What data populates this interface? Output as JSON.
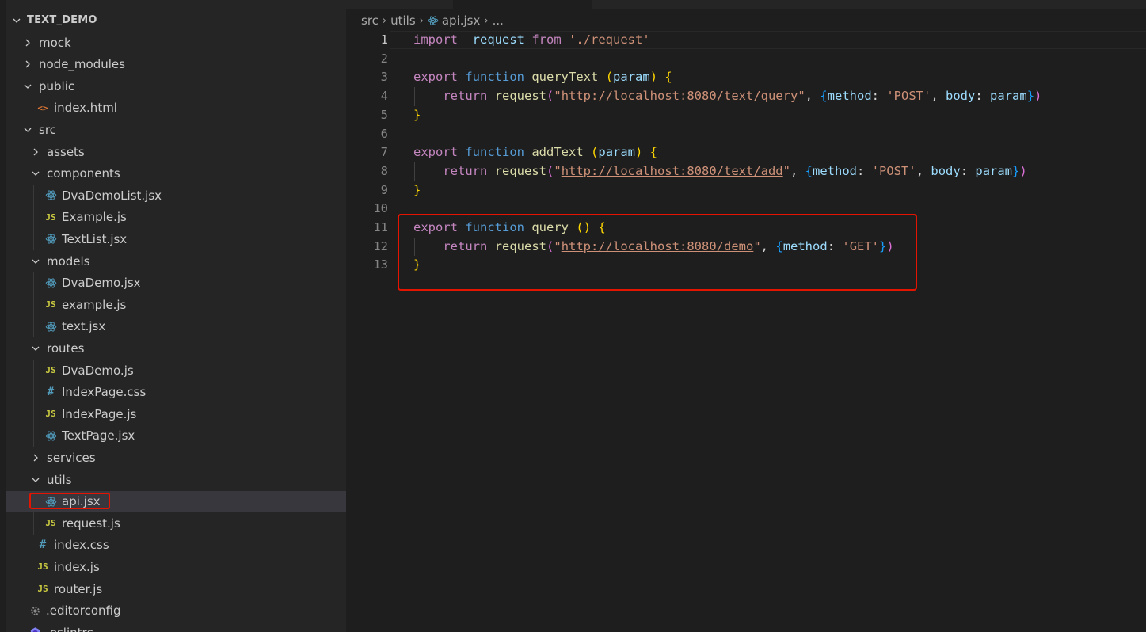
{
  "explorer": {
    "root": "TEXT_DEMO",
    "items": [
      {
        "label": "mock",
        "type": "folder",
        "open": false,
        "depth": 0
      },
      {
        "label": "node_modules",
        "type": "folder",
        "open": false,
        "depth": 0
      },
      {
        "label": "public",
        "type": "folder",
        "open": true,
        "depth": 0
      },
      {
        "label": "index.html",
        "type": "html",
        "depth": 1
      },
      {
        "label": "src",
        "type": "folder",
        "open": true,
        "depth": 0
      },
      {
        "label": "assets",
        "type": "folder",
        "open": false,
        "depth": 1
      },
      {
        "label": "components",
        "type": "folder",
        "open": true,
        "depth": 1
      },
      {
        "label": "DvaDemoList.jsx",
        "type": "react",
        "depth": 2
      },
      {
        "label": "Example.js",
        "type": "js",
        "depth": 2
      },
      {
        "label": "TextList.jsx",
        "type": "react",
        "depth": 2
      },
      {
        "label": "models",
        "type": "folder",
        "open": true,
        "depth": 1
      },
      {
        "label": "DvaDemo.jsx",
        "type": "react",
        "depth": 2
      },
      {
        "label": "example.js",
        "type": "js",
        "depth": 2
      },
      {
        "label": "text.jsx",
        "type": "react",
        "depth": 2
      },
      {
        "label": "routes",
        "type": "folder",
        "open": true,
        "depth": 1
      },
      {
        "label": "DvaDemo.js",
        "type": "js",
        "depth": 2
      },
      {
        "label": "IndexPage.css",
        "type": "css",
        "depth": 2
      },
      {
        "label": "IndexPage.js",
        "type": "js",
        "depth": 2
      },
      {
        "label": "TextPage.jsx",
        "type": "react",
        "depth": 2
      },
      {
        "label": "services",
        "type": "folder",
        "open": false,
        "depth": 1
      },
      {
        "label": "utils",
        "type": "folder",
        "open": true,
        "depth": 1
      },
      {
        "label": "api.jsx",
        "type": "react",
        "depth": 2,
        "selected": true
      },
      {
        "label": "request.js",
        "type": "js",
        "depth": 2
      },
      {
        "label": "index.css",
        "type": "css",
        "depth": 1
      },
      {
        "label": "index.js",
        "type": "js",
        "depth": 1
      },
      {
        "label": "router.js",
        "type": "js",
        "depth": 1
      },
      {
        "label": ".editorconfig",
        "type": "config",
        "depth": 0
      },
      {
        "label": ".eslintrc",
        "type": "eslint",
        "depth": 0
      }
    ]
  },
  "breadcrumb": {
    "parts": [
      "src",
      "utils",
      "api.jsx",
      "..."
    ]
  },
  "editor": {
    "file": "api.jsx",
    "active_line": 1,
    "lines": [
      {
        "n": "1",
        "tokens": [
          [
            "kw",
            "import"
          ],
          [
            "pl",
            "  "
          ],
          [
            "id",
            "request"
          ],
          [
            "pl",
            " "
          ],
          [
            "kw",
            "from"
          ],
          [
            "pl",
            " "
          ],
          [
            "str",
            "'./request'"
          ]
        ]
      },
      {
        "n": "2",
        "tokens": []
      },
      {
        "n": "3",
        "tokens": [
          [
            "kw",
            "export"
          ],
          [
            "pl",
            " "
          ],
          [
            "kwb",
            "function"
          ],
          [
            "pl",
            " "
          ],
          [
            "fn",
            "queryText"
          ],
          [
            "pl",
            " "
          ],
          [
            "br1",
            "("
          ],
          [
            "id",
            "param"
          ],
          [
            "br1",
            ")"
          ],
          [
            "pl",
            " "
          ],
          [
            "br1",
            "{"
          ]
        ]
      },
      {
        "n": "4",
        "tokens": [
          [
            "pl",
            "    "
          ],
          [
            "kw",
            "return"
          ],
          [
            "pl",
            " "
          ],
          [
            "fn",
            "request"
          ],
          [
            "br2",
            "("
          ],
          [
            "str",
            "\""
          ],
          [
            "url",
            "http://localhost:8080/text/query"
          ],
          [
            "str",
            "\""
          ],
          [
            "pl",
            ", "
          ],
          [
            "br3",
            "{"
          ],
          [
            "id",
            "method"
          ],
          [
            "pl",
            ": "
          ],
          [
            "str",
            "'POST'"
          ],
          [
            "pl",
            ", "
          ],
          [
            "id",
            "body"
          ],
          [
            "pl",
            ": "
          ],
          [
            "id",
            "param"
          ],
          [
            "br3",
            "}"
          ],
          [
            "br2",
            ")"
          ]
        ]
      },
      {
        "n": "5",
        "tokens": [
          [
            "br1",
            "}"
          ]
        ]
      },
      {
        "n": "6",
        "tokens": []
      },
      {
        "n": "7",
        "tokens": [
          [
            "kw",
            "export"
          ],
          [
            "pl",
            " "
          ],
          [
            "kwb",
            "function"
          ],
          [
            "pl",
            " "
          ],
          [
            "fn",
            "addText"
          ],
          [
            "pl",
            " "
          ],
          [
            "br1",
            "("
          ],
          [
            "id",
            "param"
          ],
          [
            "br1",
            ")"
          ],
          [
            "pl",
            " "
          ],
          [
            "br1",
            "{"
          ]
        ]
      },
      {
        "n": "8",
        "tokens": [
          [
            "pl",
            "    "
          ],
          [
            "kw",
            "return"
          ],
          [
            "pl",
            " "
          ],
          [
            "fn",
            "request"
          ],
          [
            "br2",
            "("
          ],
          [
            "str",
            "\""
          ],
          [
            "url",
            "http://localhost:8080/text/add"
          ],
          [
            "str",
            "\""
          ],
          [
            "pl",
            ", "
          ],
          [
            "br3",
            "{"
          ],
          [
            "id",
            "method"
          ],
          [
            "pl",
            ": "
          ],
          [
            "str",
            "'POST'"
          ],
          [
            "pl",
            ", "
          ],
          [
            "id",
            "body"
          ],
          [
            "pl",
            ": "
          ],
          [
            "id",
            "param"
          ],
          [
            "br3",
            "}"
          ],
          [
            "br2",
            ")"
          ]
        ]
      },
      {
        "n": "9",
        "tokens": [
          [
            "br1",
            "}"
          ]
        ]
      },
      {
        "n": "10",
        "tokens": []
      },
      {
        "n": "11",
        "tokens": [
          [
            "kw",
            "export"
          ],
          [
            "pl",
            " "
          ],
          [
            "kwb",
            "function"
          ],
          [
            "pl",
            " "
          ],
          [
            "fn",
            "query"
          ],
          [
            "pl",
            " "
          ],
          [
            "br1",
            "()"
          ],
          [
            "pl",
            " "
          ],
          [
            "br1",
            "{"
          ]
        ]
      },
      {
        "n": "12",
        "tokens": [
          [
            "pl",
            "    "
          ],
          [
            "kw",
            "return"
          ],
          [
            "pl",
            " "
          ],
          [
            "fn",
            "request"
          ],
          [
            "br2",
            "("
          ],
          [
            "str",
            "\""
          ],
          [
            "url",
            "http://localhost:8080/demo"
          ],
          [
            "str",
            "\""
          ],
          [
            "pl",
            ", "
          ],
          [
            "br3",
            "{"
          ],
          [
            "id",
            "method"
          ],
          [
            "pl",
            ": "
          ],
          [
            "str",
            "'GET'"
          ],
          [
            "br3",
            "}"
          ],
          [
            "br2",
            ")"
          ]
        ]
      },
      {
        "n": "13",
        "tokens": [
          [
            "br1",
            "}"
          ]
        ]
      }
    ]
  },
  "colors": {
    "highlight_box": "#e51400",
    "editor_bg": "#1e1e1e",
    "sidebar_bg": "#252526"
  }
}
